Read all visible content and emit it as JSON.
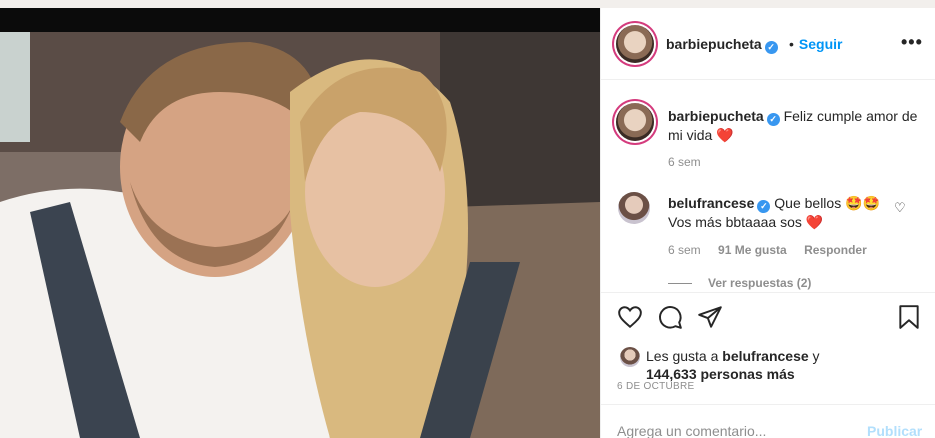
{
  "post": {
    "username": "barbiepucheta",
    "follow_label": "Seguir",
    "more_label": "•••"
  },
  "caption": {
    "username": "barbiepucheta",
    "text": "Feliz cumple amor de mi vida",
    "emoji": "❤️",
    "time": "6 sem"
  },
  "comment": {
    "username": "belufrancese",
    "text_line1": "Que bellos 🤩🤩",
    "text_line2": "Vos más bbtaaaa sos",
    "emoji": "❤️",
    "time": "6 sem",
    "likes": "91 Me gusta",
    "reply_label": "Responder",
    "view_replies": "Ver respuestas (2)"
  },
  "likes": {
    "prefix": "Les gusta a",
    "user": "belufrancese",
    "suffix": "y",
    "count": "144,633 personas más"
  },
  "date": "6 DE OCTUBRE",
  "add_comment": {
    "placeholder": "Agrega un comentario...",
    "post_label": "Publicar"
  },
  "icons": {
    "verified": "verified-badge-icon",
    "like": "heart-icon",
    "comment": "comment-icon",
    "share": "share-icon",
    "save": "bookmark-icon"
  },
  "colors": {
    "link": "#0095f6",
    "verified": "#3897f0",
    "heart": "#ed4956",
    "muted": "#8e8e8e"
  }
}
